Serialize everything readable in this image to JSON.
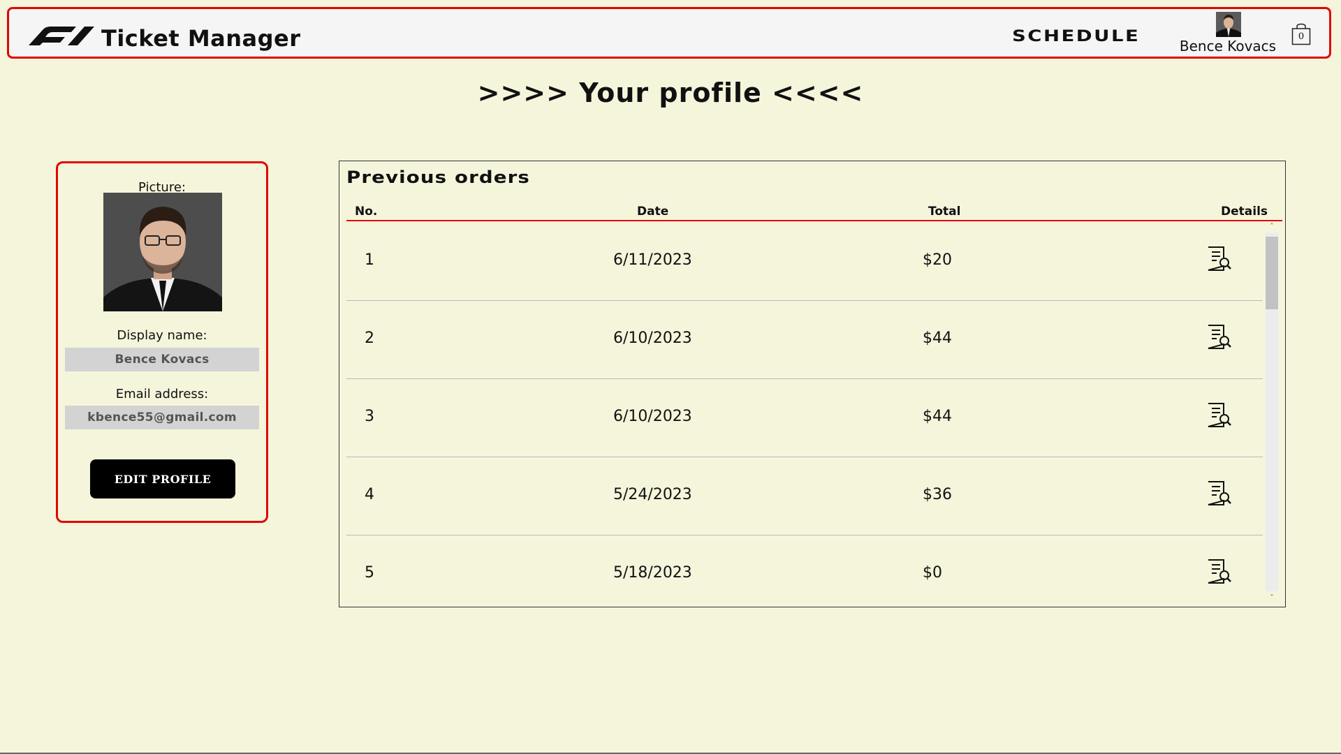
{
  "header": {
    "app_title": "Ticket Manager",
    "nav_schedule": "SCHEDULE",
    "user_name": "Bence Kovacs",
    "cart_count": "0",
    "brand_color": "#e10600"
  },
  "page": {
    "title": ">>>> Your profile <<<<",
    "background": "#f5f5dc"
  },
  "profile": {
    "picture_label": "Picture:",
    "display_name_label": "Display name:",
    "display_name_value": "Bence Kovacs",
    "email_label": "Email address:",
    "email_value": "kbence55@gmail.com",
    "edit_button": "EDIT PROFILE"
  },
  "orders": {
    "title": "Previous orders",
    "columns": {
      "no": "No.",
      "date": "Date",
      "total": "Total",
      "details": "Details"
    },
    "rows": [
      {
        "no": "1",
        "date": "6/11/2023",
        "total": "$20"
      },
      {
        "no": "2",
        "date": "6/10/2023",
        "total": "$44"
      },
      {
        "no": "3",
        "date": "6/10/2023",
        "total": "$44"
      },
      {
        "no": "4",
        "date": "5/24/2023",
        "total": "$36"
      },
      {
        "no": "5",
        "date": "5/18/2023",
        "total": "$0"
      }
    ],
    "details_icon": "receipt-search-icon"
  }
}
